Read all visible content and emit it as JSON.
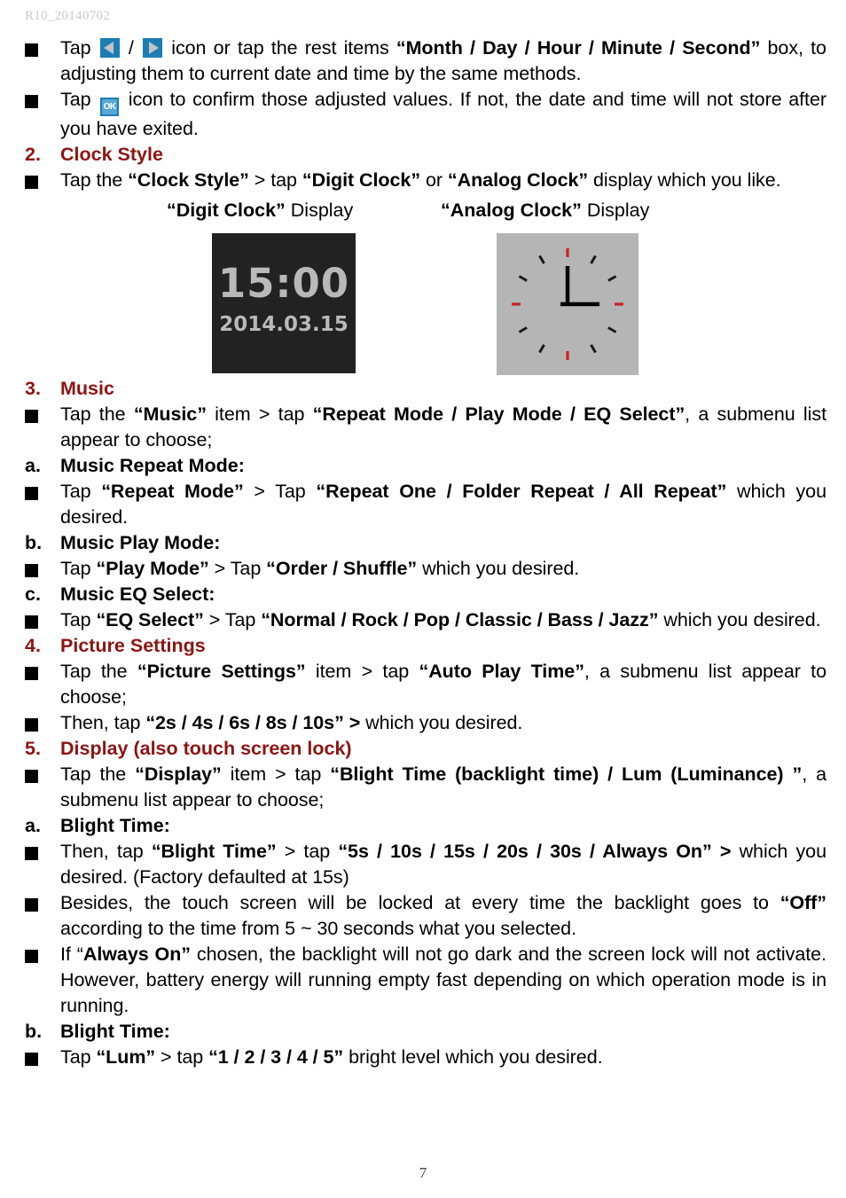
{
  "document": {
    "header": "R10_20140702",
    "page_number": "7"
  },
  "colors": {
    "heading_red": "#8C1512",
    "icon_blue": "#1C7DB5",
    "digit_clock_bg": "#222222",
    "digit_clock_fg": "#b9b9b9",
    "analog_clock_bg": "#b5b5b5",
    "analog_tick_red": "#cc2222",
    "analog_tick_black": "#1a1a1a",
    "header_gray": "#c9c9c9"
  },
  "icons": {
    "left_arrow": "left-arrow-icon",
    "right_arrow": "right-arrow-icon",
    "ok_button": "ok-confirm-icon",
    "ok_label": "OK",
    "bullet": "square-bullet-icon"
  },
  "blocks": [
    {
      "type": "bullet",
      "id": "tap-arrow-adjust",
      "parts": [
        {
          "t": "text",
          "v": "Tap "
        },
        {
          "t": "icon",
          "v": "left-arrow-icon"
        },
        {
          "t": "text",
          "v": " / "
        },
        {
          "t": "icon",
          "v": "right-arrow-icon"
        },
        {
          "t": "text",
          "v": "  icon or tap the rest items "
        },
        {
          "t": "bold",
          "v": "“Month / Day / Hour / Minute / Second”"
        },
        {
          "t": "text",
          "v": " box, to adjusting them to current date and time by the same methods."
        }
      ]
    },
    {
      "type": "bullet",
      "id": "tap-ok-confirm",
      "parts": [
        {
          "t": "text",
          "v": "Tap "
        },
        {
          "t": "icon",
          "v": "ok-confirm-icon"
        },
        {
          "t": "text",
          "v": "  icon to confirm those adjusted values. If not, the date and time will not store after you have exited."
        }
      ]
    },
    {
      "type": "num-heading",
      "id": "section-clock-style",
      "num": "2.",
      "title": "Clock Style"
    },
    {
      "type": "bullet",
      "id": "clock-style-instruction",
      "parts": [
        {
          "t": "text",
          "v": "Tap the "
        },
        {
          "t": "bold",
          "v": "“Clock Style”"
        },
        {
          "t": "text",
          "v": " > tap "
        },
        {
          "t": "bold",
          "v": "“Digit Clock”"
        },
        {
          "t": "text",
          "v": " or "
        },
        {
          "t": "bold",
          "v": "“Analog Clock”"
        },
        {
          "t": "text",
          "v": " display which you like."
        }
      ]
    },
    {
      "type": "figure",
      "id": "clock-figures"
    },
    {
      "type": "num-heading",
      "id": "section-music",
      "num": "3.",
      "title": "Music"
    },
    {
      "type": "bullet",
      "id": "music-instruction",
      "parts": [
        {
          "t": "text",
          "v": "Tap the "
        },
        {
          "t": "bold",
          "v": "“Music”"
        },
        {
          "t": "text",
          "v": " item > tap "
        },
        {
          "t": "bold",
          "v": "“Repeat Mode / Play Mode / EQ Select”"
        },
        {
          "t": "text",
          "v": ", a submenu list appear to choose;"
        }
      ]
    },
    {
      "type": "alpha-heading",
      "id": "sub-music-repeat-mode",
      "num": "a.",
      "title": "Music Repeat Mode:"
    },
    {
      "type": "bullet",
      "id": "repeat-mode-instruction",
      "parts": [
        {
          "t": "text",
          "v": "Tap "
        },
        {
          "t": "bold",
          "v": "“Repeat Mode”"
        },
        {
          "t": "text",
          "v": " > Tap "
        },
        {
          "t": "bold",
          "v": "“Repeat One / Folder Repeat / All Repeat”"
        },
        {
          "t": "text",
          "v": " which you desired."
        }
      ]
    },
    {
      "type": "alpha-heading",
      "id": "sub-music-play-mode",
      "num": "b.",
      "title": "Music Play Mode:"
    },
    {
      "type": "bullet",
      "id": "play-mode-instruction",
      "nojust": true,
      "parts": [
        {
          "t": "text",
          "v": "Tap "
        },
        {
          "t": "bold",
          "v": "“Play Mode”"
        },
        {
          "t": "text",
          "v": " > Tap "
        },
        {
          "t": "bold",
          "v": "“Order / Shuffle”"
        },
        {
          "t": "text",
          "v": " which you desired."
        }
      ]
    },
    {
      "type": "alpha-heading",
      "id": "sub-music-eq-select",
      "num": "c.",
      "title": "Music EQ Select:"
    },
    {
      "type": "bullet",
      "id": "eq-select-instruction",
      "parts": [
        {
          "t": "text",
          "v": "Tap "
        },
        {
          "t": "bold",
          "v": "“EQ Select”"
        },
        {
          "t": "text",
          "v": " > Tap "
        },
        {
          "t": "bold",
          "v": "“Normal / Rock / Pop / Classic / Bass / Jazz”"
        },
        {
          "t": "text",
          "v": " which you desired."
        }
      ]
    },
    {
      "type": "num-heading",
      "id": "section-picture-settings",
      "num": "4.",
      "title": "Picture Settings"
    },
    {
      "type": "bullet",
      "id": "picture-settings-instruction",
      "parts": [
        {
          "t": "text",
          "v": "Tap the "
        },
        {
          "t": "bold",
          "v": "“Picture Settings”"
        },
        {
          "t": "text",
          "v": " item > tap "
        },
        {
          "t": "bold",
          "v": "“Auto Play Time”"
        },
        {
          "t": "text",
          "v": ", a submenu list appear to choose;"
        }
      ]
    },
    {
      "type": "bullet",
      "id": "auto-play-time-instruction",
      "nojust": true,
      "parts": [
        {
          "t": "text",
          "v": "Then, tap "
        },
        {
          "t": "bold",
          "v": "“2s / 4s / 6s / 8s / 10s” >"
        },
        {
          "t": "text",
          "v": " which you desired."
        }
      ]
    },
    {
      "type": "num-heading",
      "id": "section-display",
      "num": "5.",
      "title": "Display (also touch screen lock)"
    },
    {
      "type": "bullet",
      "id": "display-instruction",
      "parts": [
        {
          "t": "text",
          "v": "Tap the "
        },
        {
          "t": "bold",
          "v": "“Display”"
        },
        {
          "t": "text",
          "v": " item > tap "
        },
        {
          "t": "bold",
          "v": "“Blight Time (backlight time) / Lum (Luminance) ”"
        },
        {
          "t": "text",
          "v": ", a submenu list appear to choose;"
        }
      ]
    },
    {
      "type": "alpha-heading",
      "id": "sub-blight-time-a",
      "num": "a.",
      "title": "Blight Time:"
    },
    {
      "type": "bullet",
      "id": "blight-time-instruction",
      "parts": [
        {
          "t": "text",
          "v": "Then, tap "
        },
        {
          "t": "bold",
          "v": "“Blight Time”"
        },
        {
          "t": "text",
          "v": " > tap "
        },
        {
          "t": "bold",
          "v": "“5s / 10s / 15s / 20s / 30s / Always On” >"
        },
        {
          "t": "text",
          "v": " which you desired. (Factory defaulted at 15s)"
        }
      ]
    },
    {
      "type": "bullet",
      "id": "touch-lock-note",
      "parts": [
        {
          "t": "text",
          "v": "Besides, the touch screen will be locked at every time the backlight goes to "
        },
        {
          "t": "bold",
          "v": "“Off”"
        },
        {
          "t": "text",
          "v": " according to the time from 5 ~ 30 seconds what you selected."
        }
      ]
    },
    {
      "type": "bullet",
      "id": "always-on-note",
      "parts": [
        {
          "t": "text",
          "v": "If “"
        },
        {
          "t": "bold",
          "v": "Always On”"
        },
        {
          "t": "text",
          "v": " chosen, the backlight will not go dark and the screen lock will not activate. However, battery energy will running empty fast depending on which operation mode is in running."
        }
      ]
    },
    {
      "type": "alpha-heading",
      "id": "sub-blight-time-b",
      "num": "b.",
      "title": "Blight Time:"
    },
    {
      "type": "bullet",
      "id": "lum-instruction",
      "nojust": true,
      "parts": [
        {
          "t": "text",
          "v": "Tap "
        },
        {
          "t": "bold",
          "v": "“Lum”"
        },
        {
          "t": "text",
          "v": " > tap "
        },
        {
          "t": "bold",
          "v": "“1 / 2 / 3 / 4 / 5”"
        },
        {
          "t": "text",
          "v": " bright level which you desired."
        }
      ]
    }
  ],
  "figures": {
    "digit": {
      "caption_bold": "“Digit Clock”",
      "caption_rest": " Display",
      "time": "15:00",
      "date": "2014.03.15"
    },
    "analog": {
      "caption_bold": "“Analog Clock”",
      "caption_rest": " Display",
      "hour_hand": "12",
      "minute_hand": "3"
    }
  }
}
